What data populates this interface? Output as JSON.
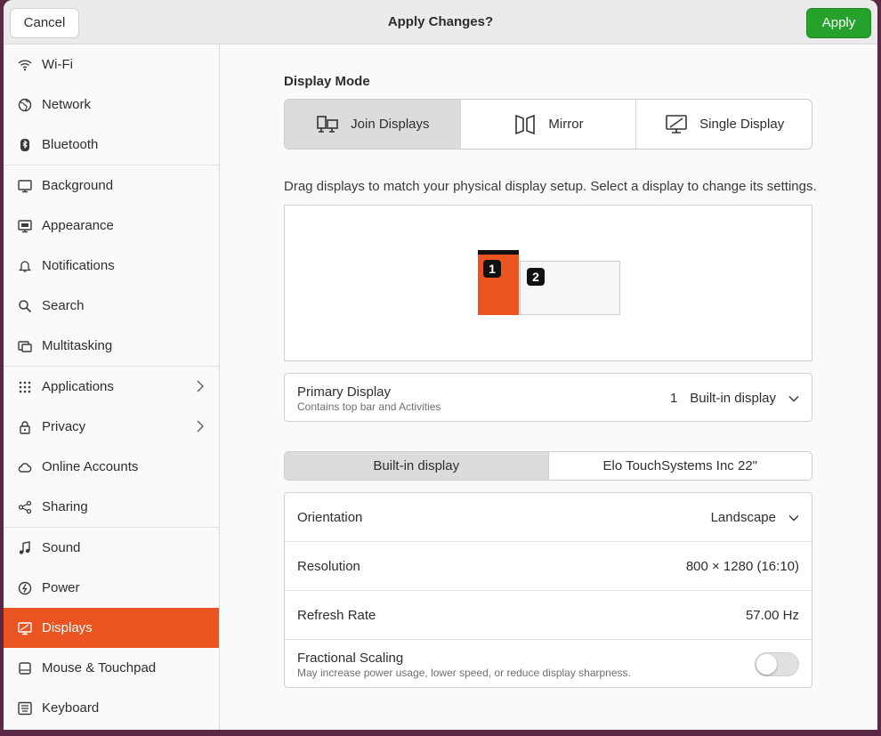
{
  "titlebar": {
    "cancel_label": "Cancel",
    "title": "Apply Changes?",
    "apply_label": "Apply"
  },
  "colors": {
    "accent": "#e95420",
    "apply": "#26a12b"
  },
  "sidebar": {
    "items": [
      {
        "label": "Wi-Fi",
        "icon": "wifi-icon"
      },
      {
        "label": "Network",
        "icon": "network-icon"
      },
      {
        "label": "Bluetooth",
        "icon": "bluetooth-icon"
      },
      {
        "label": "Background",
        "icon": "background-icon"
      },
      {
        "label": "Appearance",
        "icon": "appearance-icon"
      },
      {
        "label": "Notifications",
        "icon": "bell-icon"
      },
      {
        "label": "Search",
        "icon": "search-icon"
      },
      {
        "label": "Multitasking",
        "icon": "multitasking-icon"
      },
      {
        "label": "Applications",
        "icon": "grid-icon"
      },
      {
        "label": "Privacy",
        "icon": "lock-icon"
      },
      {
        "label": "Online Accounts",
        "icon": "cloud-icon"
      },
      {
        "label": "Sharing",
        "icon": "share-icon"
      },
      {
        "label": "Sound",
        "icon": "music-note-icon"
      },
      {
        "label": "Power",
        "icon": "power-icon"
      },
      {
        "label": "Displays",
        "icon": "display-icon"
      },
      {
        "label": "Mouse & Touchpad",
        "icon": "mouse-icon"
      },
      {
        "label": "Keyboard",
        "icon": "keyboard-icon"
      }
    ],
    "active": "Displays"
  },
  "display_mode": {
    "label": "Display Mode",
    "options": [
      "Join Displays",
      "Mirror",
      "Single Display"
    ],
    "selected": "Join Displays"
  },
  "arrangement": {
    "hint": "Drag displays to match your physical display setup. Select a display to change its settings.",
    "monitor1": "1",
    "monitor2": "2"
  },
  "primary_display": {
    "title": "Primary Display",
    "subtitle": "Contains top bar and Activities",
    "number": "1",
    "value": "Built-in display"
  },
  "display_tabs": {
    "tab1": "Built-in display",
    "tab2": "Elo TouchSystems Inc 22\""
  },
  "settings": {
    "orientation_label": "Orientation",
    "orientation_value": "Landscape",
    "resolution_label": "Resolution",
    "resolution_value": "800 × 1280 (16:10)",
    "refresh_label": "Refresh Rate",
    "refresh_value": "57.00 Hz",
    "scaling_label": "Fractional Scaling",
    "scaling_sub": "May increase power usage, lower speed, or reduce display sharpness.",
    "scaling_enabled": false
  }
}
